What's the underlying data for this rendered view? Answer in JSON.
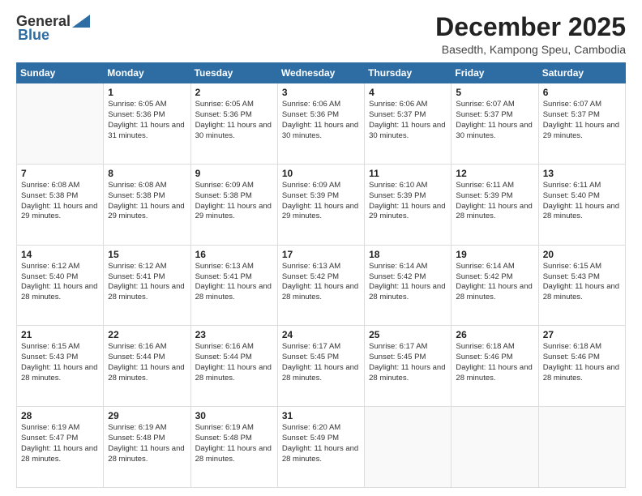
{
  "logo": {
    "line1": "General",
    "line2": "Blue"
  },
  "title": "December 2025",
  "location": "Basedth, Kampong Speu, Cambodia",
  "days_header": [
    "Sunday",
    "Monday",
    "Tuesday",
    "Wednesday",
    "Thursday",
    "Friday",
    "Saturday"
  ],
  "weeks": [
    [
      {
        "day": "",
        "sunrise": "",
        "sunset": "",
        "daylight": ""
      },
      {
        "day": "1",
        "sunrise": "Sunrise: 6:05 AM",
        "sunset": "Sunset: 5:36 PM",
        "daylight": "Daylight: 11 hours and 31 minutes."
      },
      {
        "day": "2",
        "sunrise": "Sunrise: 6:05 AM",
        "sunset": "Sunset: 5:36 PM",
        "daylight": "Daylight: 11 hours and 30 minutes."
      },
      {
        "day": "3",
        "sunrise": "Sunrise: 6:06 AM",
        "sunset": "Sunset: 5:36 PM",
        "daylight": "Daylight: 11 hours and 30 minutes."
      },
      {
        "day": "4",
        "sunrise": "Sunrise: 6:06 AM",
        "sunset": "Sunset: 5:37 PM",
        "daylight": "Daylight: 11 hours and 30 minutes."
      },
      {
        "day": "5",
        "sunrise": "Sunrise: 6:07 AM",
        "sunset": "Sunset: 5:37 PM",
        "daylight": "Daylight: 11 hours and 30 minutes."
      },
      {
        "day": "6",
        "sunrise": "Sunrise: 6:07 AM",
        "sunset": "Sunset: 5:37 PM",
        "daylight": "Daylight: 11 hours and 29 minutes."
      }
    ],
    [
      {
        "day": "7",
        "sunrise": "Sunrise: 6:08 AM",
        "sunset": "Sunset: 5:38 PM",
        "daylight": "Daylight: 11 hours and 29 minutes."
      },
      {
        "day": "8",
        "sunrise": "Sunrise: 6:08 AM",
        "sunset": "Sunset: 5:38 PM",
        "daylight": "Daylight: 11 hours and 29 minutes."
      },
      {
        "day": "9",
        "sunrise": "Sunrise: 6:09 AM",
        "sunset": "Sunset: 5:38 PM",
        "daylight": "Daylight: 11 hours and 29 minutes."
      },
      {
        "day": "10",
        "sunrise": "Sunrise: 6:09 AM",
        "sunset": "Sunset: 5:39 PM",
        "daylight": "Daylight: 11 hours and 29 minutes."
      },
      {
        "day": "11",
        "sunrise": "Sunrise: 6:10 AM",
        "sunset": "Sunset: 5:39 PM",
        "daylight": "Daylight: 11 hours and 29 minutes."
      },
      {
        "day": "12",
        "sunrise": "Sunrise: 6:11 AM",
        "sunset": "Sunset: 5:39 PM",
        "daylight": "Daylight: 11 hours and 28 minutes."
      },
      {
        "day": "13",
        "sunrise": "Sunrise: 6:11 AM",
        "sunset": "Sunset: 5:40 PM",
        "daylight": "Daylight: 11 hours and 28 minutes."
      }
    ],
    [
      {
        "day": "14",
        "sunrise": "Sunrise: 6:12 AM",
        "sunset": "Sunset: 5:40 PM",
        "daylight": "Daylight: 11 hours and 28 minutes."
      },
      {
        "day": "15",
        "sunrise": "Sunrise: 6:12 AM",
        "sunset": "Sunset: 5:41 PM",
        "daylight": "Daylight: 11 hours and 28 minutes."
      },
      {
        "day": "16",
        "sunrise": "Sunrise: 6:13 AM",
        "sunset": "Sunset: 5:41 PM",
        "daylight": "Daylight: 11 hours and 28 minutes."
      },
      {
        "day": "17",
        "sunrise": "Sunrise: 6:13 AM",
        "sunset": "Sunset: 5:42 PM",
        "daylight": "Daylight: 11 hours and 28 minutes."
      },
      {
        "day": "18",
        "sunrise": "Sunrise: 6:14 AM",
        "sunset": "Sunset: 5:42 PM",
        "daylight": "Daylight: 11 hours and 28 minutes."
      },
      {
        "day": "19",
        "sunrise": "Sunrise: 6:14 AM",
        "sunset": "Sunset: 5:42 PM",
        "daylight": "Daylight: 11 hours and 28 minutes."
      },
      {
        "day": "20",
        "sunrise": "Sunrise: 6:15 AM",
        "sunset": "Sunset: 5:43 PM",
        "daylight": "Daylight: 11 hours and 28 minutes."
      }
    ],
    [
      {
        "day": "21",
        "sunrise": "Sunrise: 6:15 AM",
        "sunset": "Sunset: 5:43 PM",
        "daylight": "Daylight: 11 hours and 28 minutes."
      },
      {
        "day": "22",
        "sunrise": "Sunrise: 6:16 AM",
        "sunset": "Sunset: 5:44 PM",
        "daylight": "Daylight: 11 hours and 28 minutes."
      },
      {
        "day": "23",
        "sunrise": "Sunrise: 6:16 AM",
        "sunset": "Sunset: 5:44 PM",
        "daylight": "Daylight: 11 hours and 28 minutes."
      },
      {
        "day": "24",
        "sunrise": "Sunrise: 6:17 AM",
        "sunset": "Sunset: 5:45 PM",
        "daylight": "Daylight: 11 hours and 28 minutes."
      },
      {
        "day": "25",
        "sunrise": "Sunrise: 6:17 AM",
        "sunset": "Sunset: 5:45 PM",
        "daylight": "Daylight: 11 hours and 28 minutes."
      },
      {
        "day": "26",
        "sunrise": "Sunrise: 6:18 AM",
        "sunset": "Sunset: 5:46 PM",
        "daylight": "Daylight: 11 hours and 28 minutes."
      },
      {
        "day": "27",
        "sunrise": "Sunrise: 6:18 AM",
        "sunset": "Sunset: 5:46 PM",
        "daylight": "Daylight: 11 hours and 28 minutes."
      }
    ],
    [
      {
        "day": "28",
        "sunrise": "Sunrise: 6:19 AM",
        "sunset": "Sunset: 5:47 PM",
        "daylight": "Daylight: 11 hours and 28 minutes."
      },
      {
        "day": "29",
        "sunrise": "Sunrise: 6:19 AM",
        "sunset": "Sunset: 5:48 PM",
        "daylight": "Daylight: 11 hours and 28 minutes."
      },
      {
        "day": "30",
        "sunrise": "Sunrise: 6:19 AM",
        "sunset": "Sunset: 5:48 PM",
        "daylight": "Daylight: 11 hours and 28 minutes."
      },
      {
        "day": "31",
        "sunrise": "Sunrise: 6:20 AM",
        "sunset": "Sunset: 5:49 PM",
        "daylight": "Daylight: 11 hours and 28 minutes."
      },
      {
        "day": "",
        "sunrise": "",
        "sunset": "",
        "daylight": ""
      },
      {
        "day": "",
        "sunrise": "",
        "sunset": "",
        "daylight": ""
      },
      {
        "day": "",
        "sunrise": "",
        "sunset": "",
        "daylight": ""
      }
    ]
  ]
}
